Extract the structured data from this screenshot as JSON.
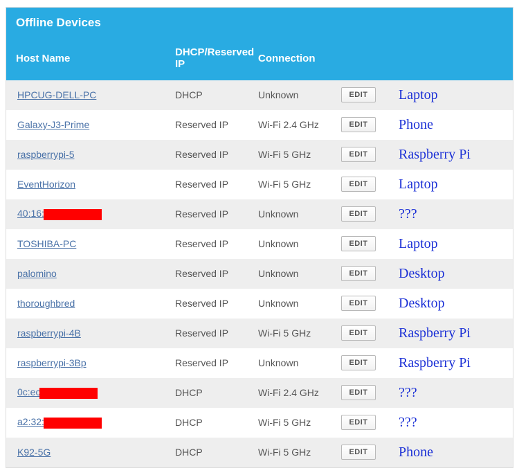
{
  "title": "Offline Devices",
  "columns": {
    "host": "Host Name",
    "dhcp": "DHCP/Reserved IP",
    "conn": "Connection"
  },
  "edit_label": "EDIT",
  "rows": [
    {
      "host": "HPCUG-DELL-PC",
      "redacted": false,
      "dhcp": "DHCP",
      "conn": "Unknown",
      "annot": "Laptop"
    },
    {
      "host": "Galaxy-J3-Prime",
      "redacted": false,
      "dhcp": "Reserved IP",
      "conn": "Wi-Fi 2.4 GHz",
      "annot": "Phone"
    },
    {
      "host": "raspberrypi-5",
      "redacted": false,
      "dhcp": "Reserved IP",
      "conn": "Wi-Fi 5 GHz",
      "annot": "Raspberry Pi"
    },
    {
      "host": "EventHorizon",
      "redacted": false,
      "dhcp": "Reserved IP",
      "conn": "Wi-Fi 5 GHz",
      "annot": "Laptop"
    },
    {
      "host": "40:16:",
      "redacted": true,
      "dhcp": "Reserved IP",
      "conn": "Unknown",
      "annot": "???"
    },
    {
      "host": "TOSHIBA-PC",
      "redacted": false,
      "dhcp": "Reserved IP",
      "conn": "Unknown",
      "annot": "Laptop"
    },
    {
      "host": "palomino",
      "redacted": false,
      "dhcp": "Reserved IP",
      "conn": "Unknown",
      "annot": "Desktop"
    },
    {
      "host": "thoroughbred",
      "redacted": false,
      "dhcp": "Reserved IP",
      "conn": "Unknown",
      "annot": "Desktop"
    },
    {
      "host": "raspberrypi-4B",
      "redacted": false,
      "dhcp": "Reserved IP",
      "conn": "Wi-Fi 5 GHz",
      "annot": "Raspberry Pi"
    },
    {
      "host": "raspberrypi-3Bp",
      "redacted": false,
      "dhcp": "Reserved IP",
      "conn": "Unknown",
      "annot": "Raspberry Pi"
    },
    {
      "host": "0c:ec",
      "redacted": true,
      "dhcp": "DHCP",
      "conn": "Wi-Fi 2.4 GHz",
      "annot": "???"
    },
    {
      "host": "a2:32:",
      "redacted": true,
      "dhcp": "DHCP",
      "conn": "Wi-Fi 5 GHz",
      "annot": "???"
    },
    {
      "host": "K92-5G",
      "redacted": false,
      "dhcp": "DHCP",
      "conn": "Wi-Fi 5 GHz",
      "annot": "Phone"
    }
  ]
}
